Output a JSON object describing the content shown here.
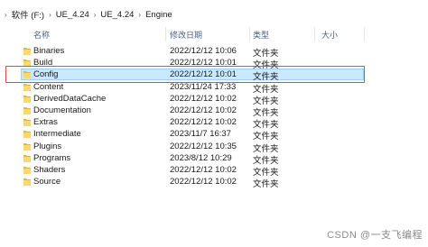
{
  "breadcrumb": [
    "软件 (F:)",
    "UE_4.24",
    "UE_4.24",
    "Engine"
  ],
  "columns": {
    "name": "名称",
    "date": "修改日期",
    "type": "类型",
    "size": "大小"
  },
  "files": [
    {
      "name": "Binaries",
      "date": "2022/12/12 10:06",
      "type": "文件夹"
    },
    {
      "name": "Build",
      "date": "2022/12/12 10:01",
      "type": "文件夹"
    },
    {
      "name": "Config",
      "date": "2022/12/12 10:01",
      "type": "文件夹",
      "selected": true
    },
    {
      "name": "Content",
      "date": "2023/11/24 17:33",
      "type": "文件夹"
    },
    {
      "name": "DerivedDataCache",
      "date": "2022/12/12 10:02",
      "type": "文件夹"
    },
    {
      "name": "Documentation",
      "date": "2022/12/12 10:02",
      "type": "文件夹"
    },
    {
      "name": "Extras",
      "date": "2022/12/12 10:02",
      "type": "文件夹"
    },
    {
      "name": "Intermediate",
      "date": "2023/11/7 16:37",
      "type": "文件夹"
    },
    {
      "name": "Plugins",
      "date": "2022/12/12 10:35",
      "type": "文件夹"
    },
    {
      "name": "Programs",
      "date": "2023/8/12 10:29",
      "type": "文件夹"
    },
    {
      "name": "Shaders",
      "date": "2022/12/12 10:02",
      "type": "文件夹"
    },
    {
      "name": "Source",
      "date": "2022/12/12 10:02",
      "type": "文件夹"
    }
  ],
  "watermark": "CSDN @一支飞编程",
  "colors": {
    "selection": "#cce8ff",
    "highlight_box": "#e04a4a",
    "folder": "#f8d775"
  }
}
